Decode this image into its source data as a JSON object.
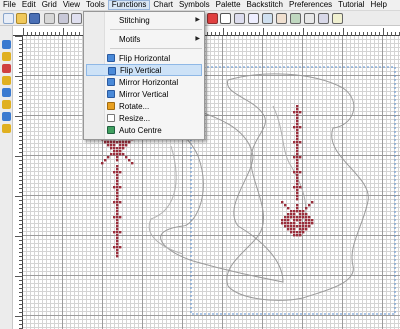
{
  "menubar": {
    "items": [
      "File",
      "Edit",
      "Grid",
      "View",
      "Tools",
      "Functions",
      "Chart",
      "Symbols",
      "Palette",
      "Backstitch",
      "Preferences",
      "Tutorial",
      "Help"
    ]
  },
  "functions_menu": {
    "items": [
      {
        "label": "Stitching",
        "icon": null,
        "submenu": true
      },
      {
        "label": "Motifs",
        "icon": null,
        "submenu": true
      },
      {
        "label": "Flip Horizontal",
        "icon": "flip-horizontal-icon"
      },
      {
        "label": "Flip Vertical",
        "icon": "flip-vertical-icon",
        "highlighted": true
      },
      {
        "label": "Mirror Horizontal",
        "icon": "mirror-horizontal-icon"
      },
      {
        "label": "Mirror Vertical",
        "icon": "mirror-vertical-icon"
      },
      {
        "label": "Rotate...",
        "icon": "rotate-icon"
      },
      {
        "label": "Resize...",
        "icon": "resize-icon"
      },
      {
        "label": "Auto Centre",
        "icon": "auto-centre-icon"
      }
    ]
  },
  "colors": {
    "stitch": "#9a2e3c",
    "highlight": "#cde2f7",
    "selection_border": "#5a8fd0"
  }
}
